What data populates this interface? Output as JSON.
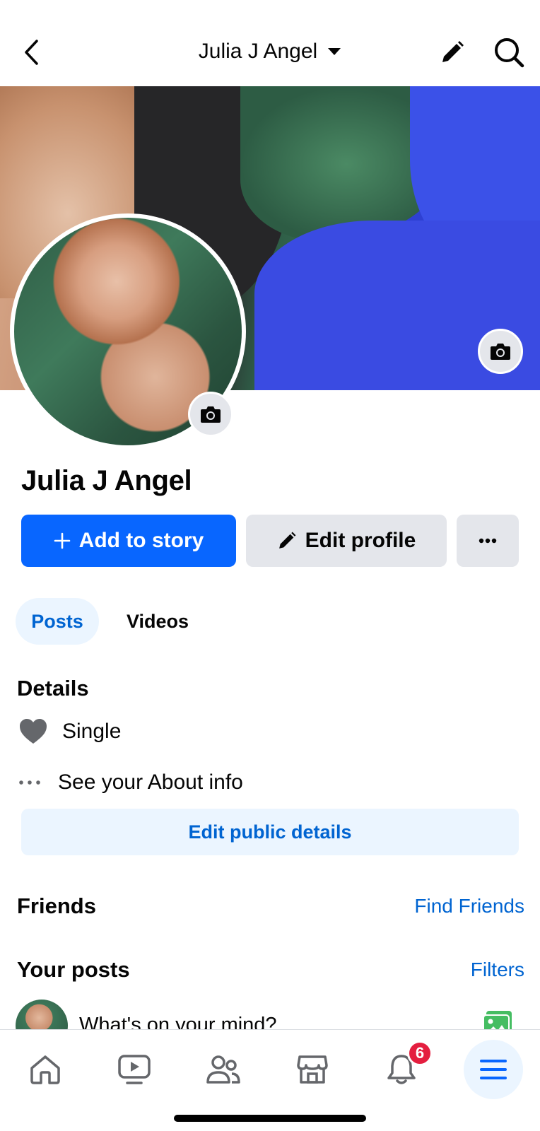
{
  "header": {
    "title": "Julia J Angel",
    "back_icon": "chevron-left-icon",
    "dropdown_icon": "caret-down-icon",
    "edit_icon": "pencil-icon",
    "search_icon": "search-icon"
  },
  "profile": {
    "name": "Julia J Angel"
  },
  "actions": {
    "add_story_label": "Add to story",
    "edit_profile_label": "Edit profile",
    "more_label": "..."
  },
  "tabs": [
    {
      "label": "Posts",
      "active": true
    },
    {
      "label": "Videos",
      "active": false
    }
  ],
  "details": {
    "title": "Details",
    "relationship": "Single",
    "about_link": "See your About info",
    "edit_button": "Edit public details"
  },
  "friends": {
    "title": "Friends",
    "find_link": "Find Friends"
  },
  "posts": {
    "title": "Your posts",
    "filters_link": "Filters",
    "composer_placeholder": "What's on your mind?"
  },
  "bottom_nav": {
    "items": [
      "home",
      "video",
      "friends",
      "marketplace",
      "notifications",
      "menu"
    ],
    "notifications_badge": "6"
  },
  "colors": {
    "accent": "#0866ff",
    "link": "#0064d1",
    "light_accent": "#ebf5ff",
    "badge": "#e41e3f",
    "button_gray": "#e4e6eb"
  }
}
